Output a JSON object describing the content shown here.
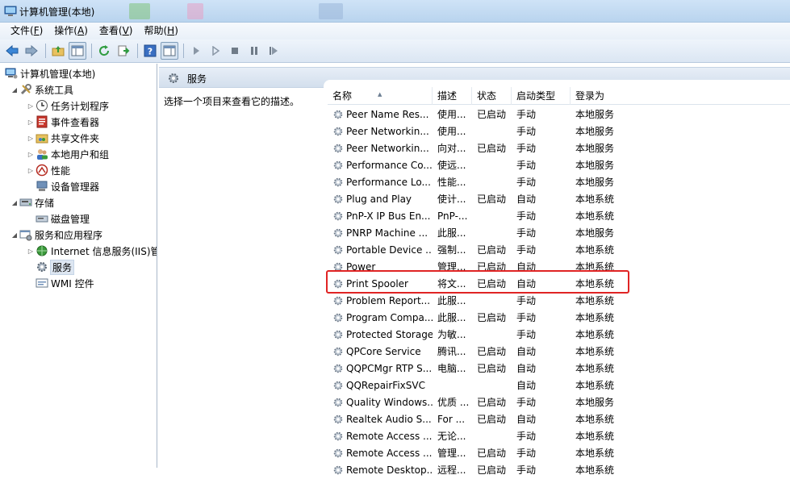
{
  "window": {
    "title": "计算机管理(本地)"
  },
  "menu": [
    {
      "label": "文件(",
      "key": "F",
      "tail": ")"
    },
    {
      "label": "操作(",
      "key": "A",
      "tail": ")"
    },
    {
      "label": "查看(",
      "key": "V",
      "tail": ")"
    },
    {
      "label": "帮助(",
      "key": "H",
      "tail": ")"
    }
  ],
  "tree": {
    "root": "计算机管理(本地)",
    "system_tools": "系统工具",
    "task_scheduler": "任务计划程序",
    "event_viewer": "事件查看器",
    "shared_folders": "共享文件夹",
    "local_users": "本地用户和组",
    "performance": "性能",
    "device_manager": "设备管理器",
    "storage": "存储",
    "disk_management": "磁盘管理",
    "services_apps": "服务和应用程序",
    "iis": "Internet 信息服务(IIS)管",
    "services": "服务",
    "wmi": "WMI 控件"
  },
  "services_panel": {
    "title": "服务",
    "description": "选择一个项目来查看它的描述。"
  },
  "columns": {
    "name": "名称",
    "description": "描述",
    "status": "状态",
    "startup": "启动类型",
    "logon": "登录为"
  },
  "services": [
    {
      "name": "Peer Name Res...",
      "desc": "使用...",
      "status": "已启动",
      "startup": "手动",
      "logon": "本地服务"
    },
    {
      "name": "Peer Networkin...",
      "desc": "使用...",
      "status": "",
      "startup": "手动",
      "logon": "本地服务"
    },
    {
      "name": "Peer Networkin...",
      "desc": "向对...",
      "status": "已启动",
      "startup": "手动",
      "logon": "本地服务"
    },
    {
      "name": "Performance Co...",
      "desc": "使远...",
      "status": "",
      "startup": "手动",
      "logon": "本地服务"
    },
    {
      "name": "Performance Lo...",
      "desc": "性能...",
      "status": "",
      "startup": "手动",
      "logon": "本地服务"
    },
    {
      "name": "Plug and Play",
      "desc": "使计...",
      "status": "已启动",
      "startup": "自动",
      "logon": "本地系统"
    },
    {
      "name": "PnP-X IP Bus En...",
      "desc": "PnP-...",
      "status": "",
      "startup": "手动",
      "logon": "本地系统"
    },
    {
      "name": "PNRP Machine ...",
      "desc": "此服...",
      "status": "",
      "startup": "手动",
      "logon": "本地服务"
    },
    {
      "name": "Portable Device ...",
      "desc": "强制...",
      "status": "已启动",
      "startup": "手动",
      "logon": "本地系统"
    },
    {
      "name": "Power",
      "desc": "管理...",
      "status": "已启动",
      "startup": "自动",
      "logon": "本地系统"
    },
    {
      "name": "Print Spooler",
      "desc": "将文...",
      "status": "已启动",
      "startup": "自动",
      "logon": "本地系统"
    },
    {
      "name": "Problem Report...",
      "desc": "此服...",
      "status": "",
      "startup": "手动",
      "logon": "本地系统"
    },
    {
      "name": "Program Compa...",
      "desc": "此服...",
      "status": "已启动",
      "startup": "手动",
      "logon": "本地系统"
    },
    {
      "name": "Protected Storage",
      "desc": "为敏...",
      "status": "",
      "startup": "手动",
      "logon": "本地系统"
    },
    {
      "name": "QPCore Service",
      "desc": "腾讯...",
      "status": "已启动",
      "startup": "自动",
      "logon": "本地系统"
    },
    {
      "name": "QQPCMgr RTP S...",
      "desc": "电脑...",
      "status": "已启动",
      "startup": "自动",
      "logon": "本地系统"
    },
    {
      "name": "QQRepairFixSVC",
      "desc": "",
      "status": "",
      "startup": "自动",
      "logon": "本地系统"
    },
    {
      "name": "Quality Windows...",
      "desc": "优质 ...",
      "status": "已启动",
      "startup": "手动",
      "logon": "本地服务"
    },
    {
      "name": "Realtek Audio S...",
      "desc": "For ...",
      "status": "已启动",
      "startup": "自动",
      "logon": "本地系统"
    },
    {
      "name": "Remote Access ...",
      "desc": "无论...",
      "status": "",
      "startup": "手动",
      "logon": "本地系统"
    },
    {
      "name": "Remote Access ...",
      "desc": "管理...",
      "status": "已启动",
      "startup": "手动",
      "logon": "本地系统"
    },
    {
      "name": "Remote Desktop...",
      "desc": "远程...",
      "status": "已启动",
      "startup": "手动",
      "logon": "本地系统"
    }
  ],
  "colors": {
    "highlight": "#e02424",
    "selection": "#dde6f1"
  }
}
